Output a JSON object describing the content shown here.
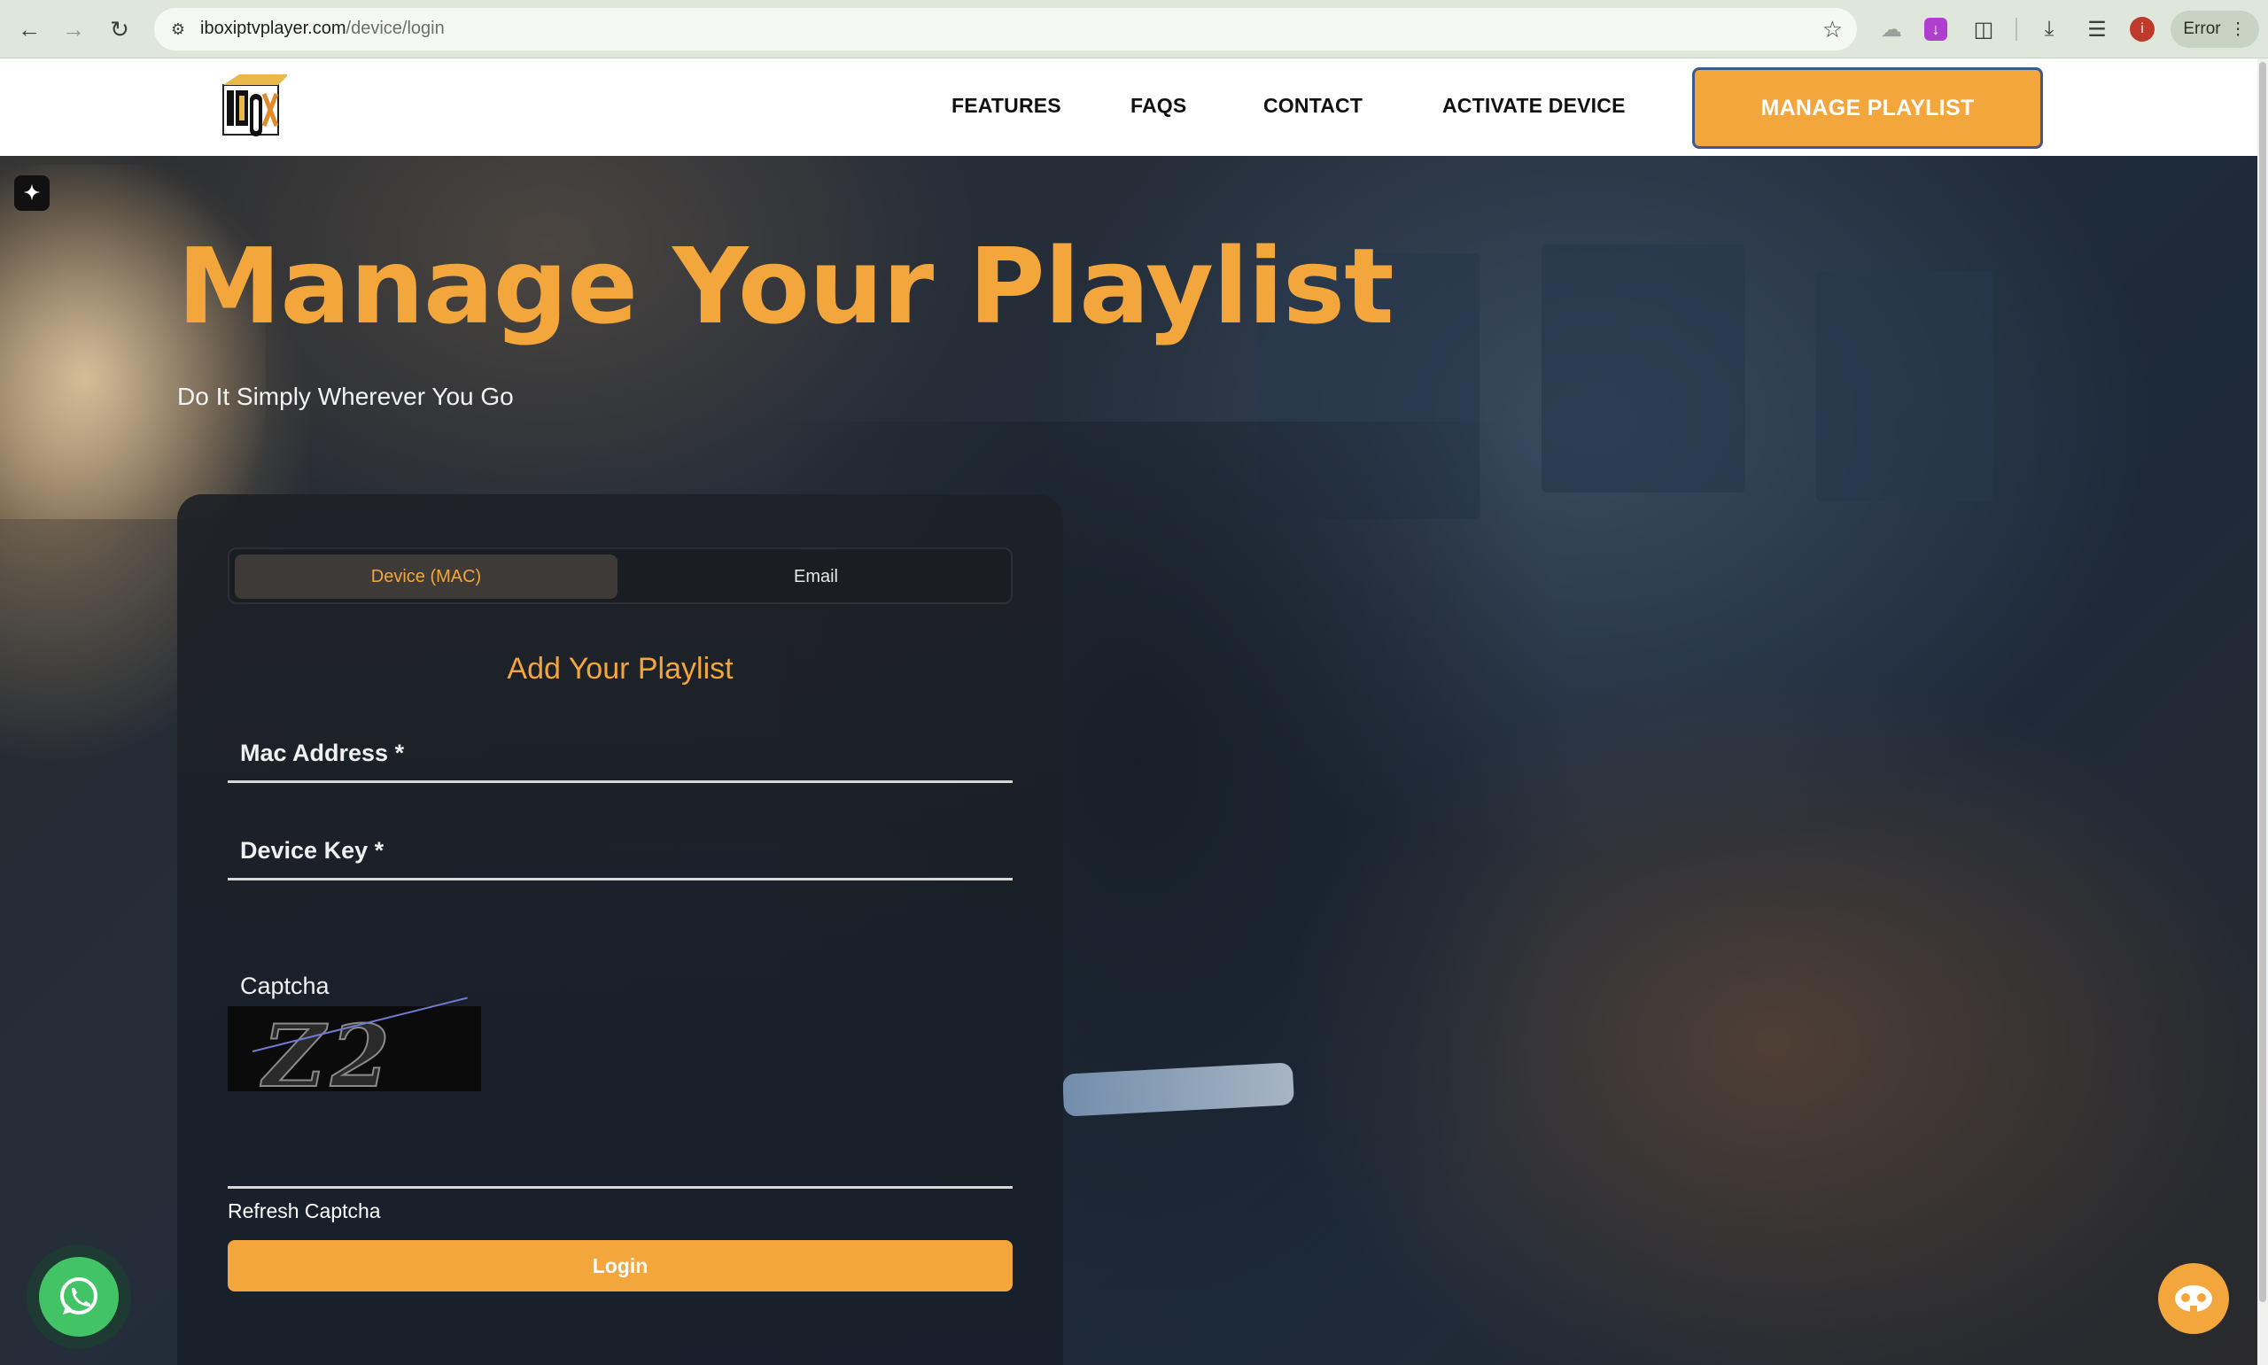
{
  "browser": {
    "url_host": "iboxiptvplayer.com",
    "url_path": "/device/login",
    "error_label": "Error",
    "profile_initial": "i"
  },
  "header": {
    "nav": [
      "FEATURES",
      "FAQS",
      "CONTACT",
      "ACTIVATE DEVICE"
    ],
    "cta": "MANAGE PLAYLIST"
  },
  "hero": {
    "title": "Manage Your Playlist",
    "subtitle": "Do It Simply Wherever You Go"
  },
  "form": {
    "tabs": [
      "Device (MAC)",
      "Email"
    ],
    "active_tab": "Device (MAC)",
    "title": "Add Your Playlist",
    "mac_placeholder": "Mac Address *",
    "key_placeholder": "Device Key *",
    "captcha_label": "Captcha",
    "captcha_image_text": "Z2",
    "refresh_label": "Refresh Captcha",
    "login_label": "Login"
  },
  "colors": {
    "accent": "#f3a63c",
    "whatsapp": "#42c466"
  },
  "icons": {
    "back": "arrow-left-icon",
    "forward": "arrow-right-icon",
    "reload": "reload-icon",
    "bookmark": "star-icon",
    "whatsapp": "whatsapp-icon",
    "chatbot": "chatbot-icon"
  }
}
